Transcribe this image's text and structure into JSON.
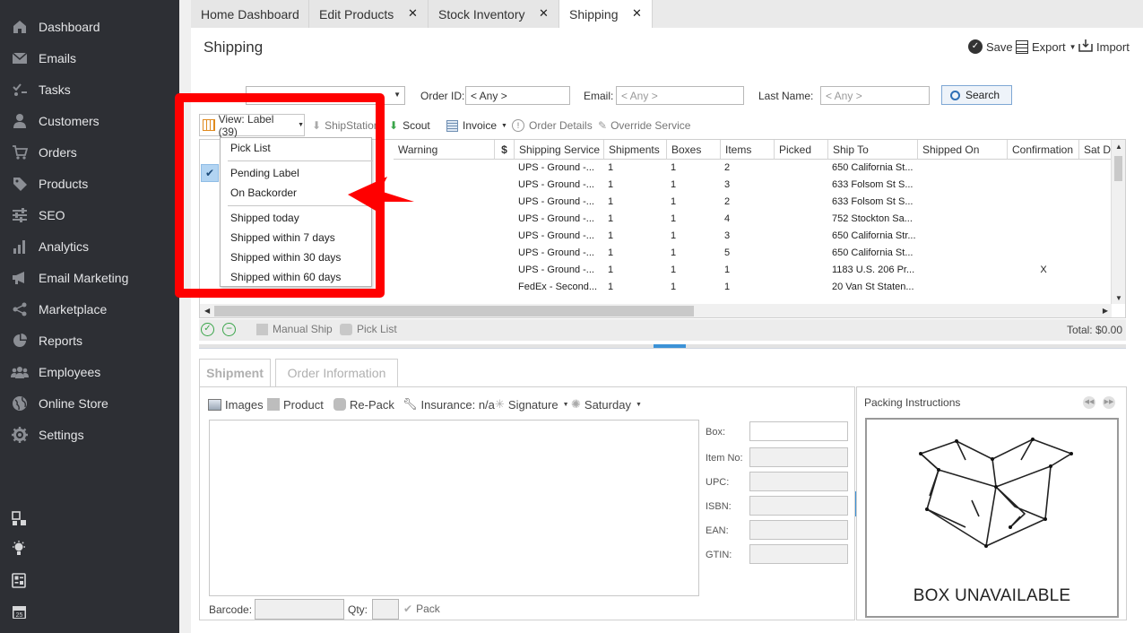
{
  "sidebar": {
    "items": [
      {
        "label": "Dashboard",
        "icon": "dashboard-icon"
      },
      {
        "label": "Emails",
        "icon": "envelope-icon"
      },
      {
        "label": "Tasks",
        "icon": "tasks-icon"
      },
      {
        "label": "Customers",
        "icon": "user-icon"
      },
      {
        "label": "Orders",
        "icon": "cart-icon"
      },
      {
        "label": "Products",
        "icon": "tag-icon"
      },
      {
        "label": "SEO",
        "icon": "sliders-icon"
      },
      {
        "label": "Analytics",
        "icon": "bar-chart-icon"
      },
      {
        "label": "Email Marketing",
        "icon": "megaphone-icon"
      },
      {
        "label": "Marketplace",
        "icon": "share-icon"
      },
      {
        "label": "Reports",
        "icon": "pie-chart-icon"
      },
      {
        "label": "Employees",
        "icon": "group-icon"
      },
      {
        "label": "Online Store",
        "icon": "globe-icon"
      },
      {
        "label": "Settings",
        "icon": "gear-icon"
      }
    ],
    "calendar_day": "25"
  },
  "tabs": [
    {
      "label": "Home Dashboard"
    },
    {
      "label": "Edit Products"
    },
    {
      "label": "Stock Inventory"
    },
    {
      "label": "Shipping"
    }
  ],
  "page": {
    "title": "Shipping",
    "save": "Save",
    "export": "Export",
    "import": "Import"
  },
  "filters": {
    "order_id_label": "Order ID:",
    "order_id_value": "< Any >",
    "email_label": "Email:",
    "email_value": "< Any >",
    "last_name_label": "Last Name:",
    "last_name_value": "< Any >",
    "search": "Search"
  },
  "toolbar": {
    "view": "View: Label (39)",
    "shipstation": "ShipStation",
    "scout": "Scout",
    "invoice": "Invoice",
    "order_details": "Order Details",
    "override_service": "Override Service"
  },
  "grid": {
    "columns": [
      "Warning",
      "",
      "Shipping Service",
      "Shipments",
      "Boxes",
      "Items",
      "Picked",
      "Ship To",
      "Shipped On",
      "Confirmation",
      "Sat De"
    ],
    "rows": [
      {
        "service": "UPS - Ground -...",
        "shipments": "1",
        "boxes": "1",
        "items": "2",
        "ship_to": "650 California St...",
        "confirmation": ""
      },
      {
        "service": "UPS - Ground -...",
        "shipments": "1",
        "boxes": "1",
        "items": "3",
        "ship_to": "633 Folsom St S...",
        "confirmation": ""
      },
      {
        "service": "UPS - Ground -...",
        "shipments": "1",
        "boxes": "1",
        "items": "2",
        "ship_to": "633 Folsom St S...",
        "confirmation": ""
      },
      {
        "service": "UPS - Ground -...",
        "shipments": "1",
        "boxes": "1",
        "items": "4",
        "ship_to": "752 Stockton Sa...",
        "confirmation": ""
      },
      {
        "service": "UPS - Ground -...",
        "shipments": "1",
        "boxes": "1",
        "items": "3",
        "ship_to": "650 California Str...",
        "confirmation": ""
      },
      {
        "service": "UPS - Ground -...",
        "shipments": "1",
        "boxes": "1",
        "items": "5",
        "ship_to": "650 California St...",
        "confirmation": ""
      },
      {
        "service": "UPS - Ground -...",
        "shipments": "1",
        "boxes": "1",
        "items": "1",
        "ship_to": "1183 U.S. 206 Pr...",
        "confirmation": "X"
      },
      {
        "service": "FedEx - Second...",
        "shipments": "1",
        "boxes": "1",
        "items": "1",
        "ship_to": "20 Van St Staten...",
        "confirmation": ""
      }
    ]
  },
  "bottombar": {
    "manual_ship": "Manual Ship",
    "pick_list": "Pick List",
    "total": "Total: $0.00"
  },
  "lower_tabs": [
    {
      "label": "Shipment"
    },
    {
      "label": "Order Information"
    }
  ],
  "shipment": {
    "images": "Images",
    "product": "Product",
    "repack": "Re-Pack",
    "insurance": "Insurance: n/a",
    "signature": "Signature",
    "saturday": "Saturday",
    "fields": [
      "Box:",
      "Item No:",
      "UPC:",
      "ISBN:",
      "EAN:",
      "GTIN:"
    ],
    "barcode_label": "Barcode:",
    "qty_label": "Qty:",
    "pack": "Pack"
  },
  "packing": {
    "title": "Packing Instructions",
    "caption": "BOX UNAVAILABLE"
  },
  "dropdown": {
    "items": [
      {
        "label": "Pick List"
      },
      {
        "label": "Pending Label",
        "checked": true
      },
      {
        "label": "On Backorder"
      },
      {
        "label": "Shipped today"
      },
      {
        "label": "Shipped within 7 days"
      },
      {
        "label": "Shipped within 30 days"
      },
      {
        "label": "Shipped within 60 days"
      }
    ]
  },
  "colors": {
    "sidebar": "#2d2f34",
    "accent": "#3c92d6",
    "highlight": "#ff0000"
  }
}
